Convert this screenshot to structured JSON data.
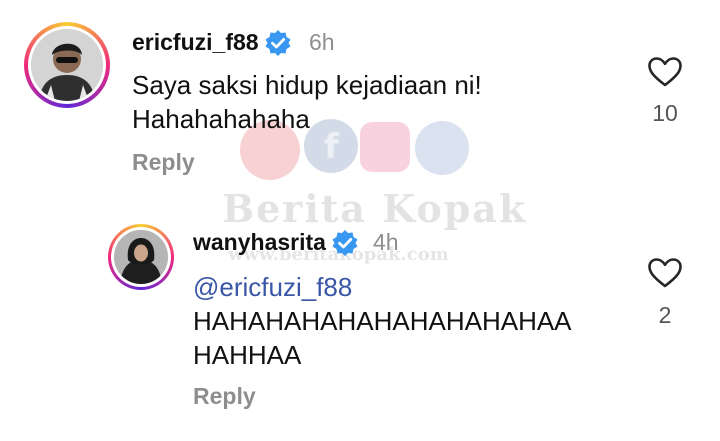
{
  "comment": {
    "username": "ericfuzi_f88",
    "time": "6h",
    "text_lines": [
      "Saya saksi hidup kejadiaan ni!",
      "Hahahahahaha"
    ],
    "reply_label": "Reply",
    "like_count": "10",
    "verified_icon": "verified-badge-icon",
    "like_icon": "heart-outline-icon"
  },
  "reply": {
    "username": "wanyhasrita",
    "time": "4h",
    "mention": "@ericfuzi_f88",
    "text_lines": [
      "HAHAHAHAHAHAHAHAHAHAA",
      "HAHHAA"
    ],
    "reply_label": "Reply",
    "like_count": "2",
    "verified_icon": "verified-badge-icon",
    "like_icon": "heart-outline-icon"
  },
  "watermark": {
    "title": "Berita Kopak",
    "url": "www.beritakopak.com"
  },
  "colors": {
    "verified": "#3897f0",
    "mention": "#3a57a7",
    "muted": "#8e8e8e"
  }
}
